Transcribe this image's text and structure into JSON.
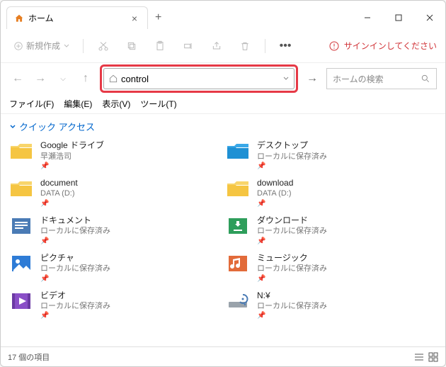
{
  "titlebar": {
    "tab_title": "ホーム"
  },
  "toolbar": {
    "new_label": "新規作成",
    "signin_label": "サインインしてください"
  },
  "address": {
    "value": "control"
  },
  "search": {
    "placeholder": "ホームの検索"
  },
  "menubar": {
    "file": "ファイル(F)",
    "edit": "編集(E)",
    "view": "表示(V)",
    "tools": "ツール(T)"
  },
  "section": {
    "quick_access": "クイック アクセス"
  },
  "items": [
    {
      "name": "Google ドライブ",
      "sub": "早瀬浩司",
      "icon": "folder-yellow"
    },
    {
      "name": "デスクトップ",
      "sub": "ローカルに保存済み",
      "icon": "folder-blue"
    },
    {
      "name": "document",
      "sub": "DATA (D:)",
      "icon": "folder-yellow"
    },
    {
      "name": "download",
      "sub": "DATA (D:)",
      "icon": "folder-yellow"
    },
    {
      "name": "ドキュメント",
      "sub": "ローカルに保存済み",
      "icon": "doc-blue"
    },
    {
      "name": "ダウンロード",
      "sub": "ローカルに保存済み",
      "icon": "download-green"
    },
    {
      "name": "ピクチャ",
      "sub": "ローカルに保存済み",
      "icon": "pictures-blue"
    },
    {
      "name": "ミュージック",
      "sub": "ローカルに保存済み",
      "icon": "music-orange"
    },
    {
      "name": "ビデオ",
      "sub": "ローカルに保存済み",
      "icon": "video-purple"
    },
    {
      "name": "N:¥",
      "sub": "ローカルに保存済み",
      "icon": "drive-gray"
    }
  ],
  "status": {
    "count": "17 個の項目"
  }
}
